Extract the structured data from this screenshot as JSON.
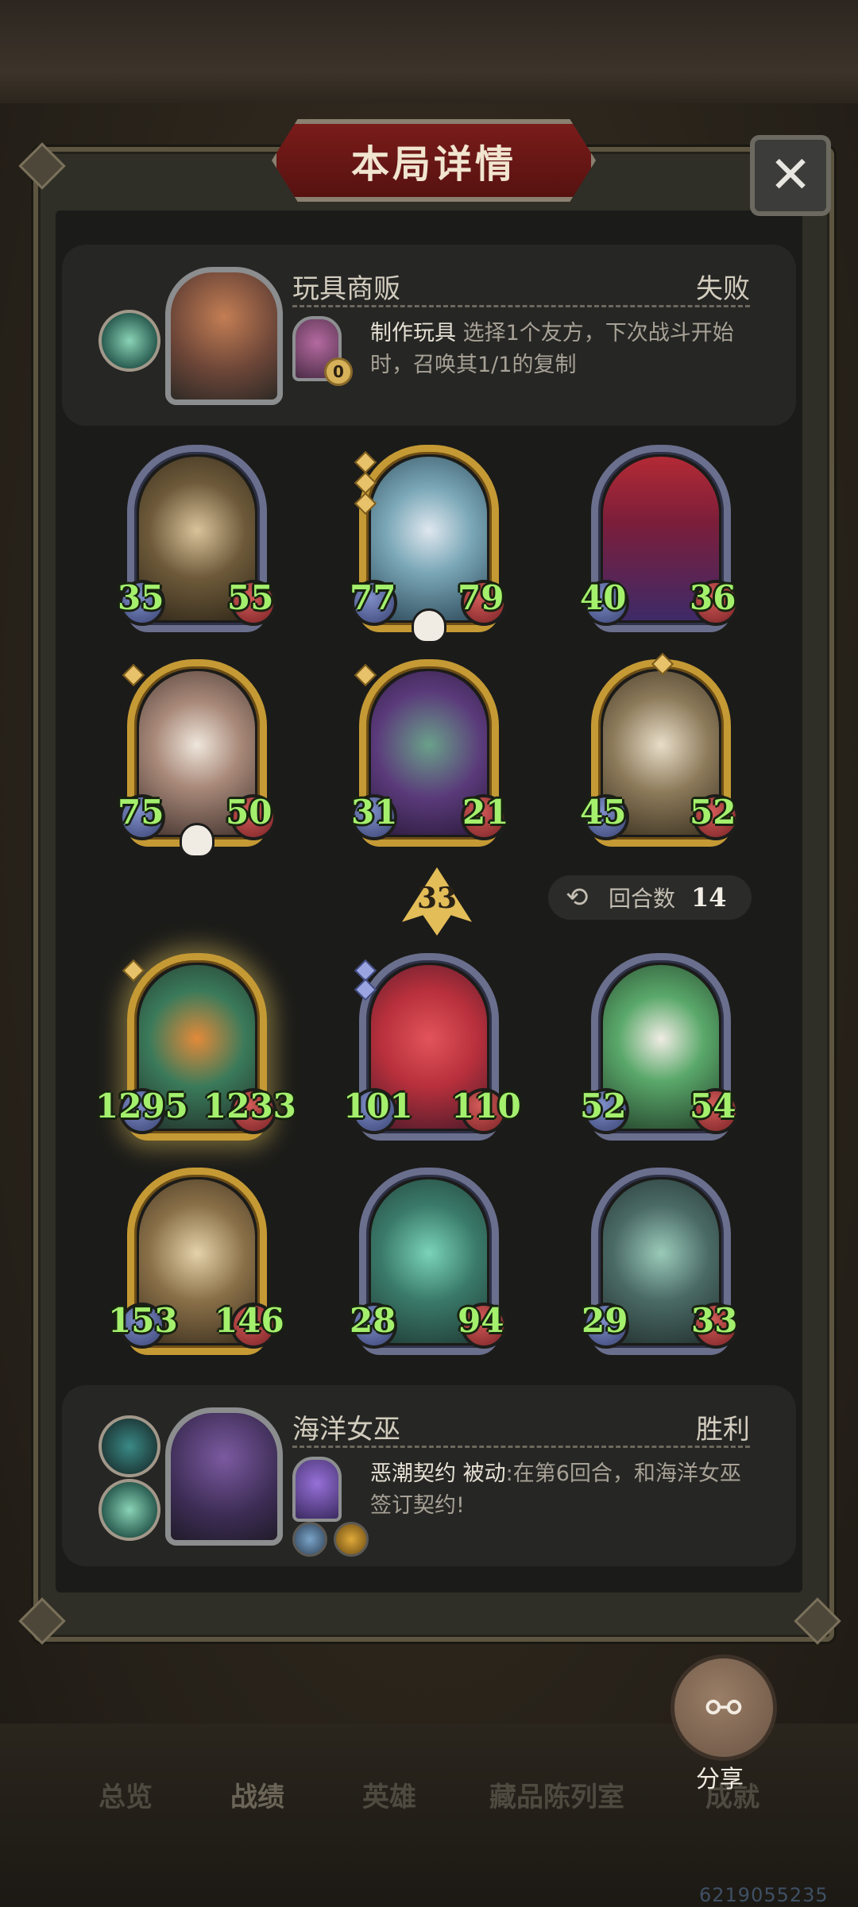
{
  "header": {
    "title": "本局详情",
    "close_glyph": "✕"
  },
  "opponent": {
    "name": "玩具商贩",
    "result": "失败",
    "ability_name": "制作玩具",
    "ability_desc": " 选择1个友方，下次战斗开始时，召唤其1/1的复制",
    "coin": "0"
  },
  "board": {
    "opponent_units": [
      {
        "atk": "35",
        "hp": "55"
      },
      {
        "atk": "77",
        "hp": "79"
      },
      {
        "atk": "40",
        "hp": "36"
      },
      {
        "atk": "75",
        "hp": "50"
      },
      {
        "atk": "31",
        "hp": "21"
      },
      {
        "atk": "45",
        "hp": "52"
      }
    ],
    "tier": "33",
    "rounds_label": "回合数",
    "rounds_value": "14",
    "player_units": [
      {
        "atk": "1295",
        "hp": "1233"
      },
      {
        "atk": "101",
        "hp": "110"
      },
      {
        "atk": "52",
        "hp": "54"
      },
      {
        "atk": "153",
        "hp": "146"
      },
      {
        "atk": "28",
        "hp": "94"
      },
      {
        "atk": "29",
        "hp": "33"
      }
    ]
  },
  "player": {
    "name": "海洋女巫",
    "result": "胜利",
    "ability_name": "恶潮契约 被动",
    "ability_desc": ":在第6回合，和海洋女巫签订契约!"
  },
  "share": {
    "label": "分享"
  },
  "tabs": [
    "总览",
    "战绩",
    "英雄",
    "藏品陈列室",
    "成就"
  ],
  "uid": "6219055235",
  "colors": {
    "stat_text": "#a4f06d",
    "gold_frame": "#c59a35",
    "title_plate": "#7a1c1a"
  }
}
